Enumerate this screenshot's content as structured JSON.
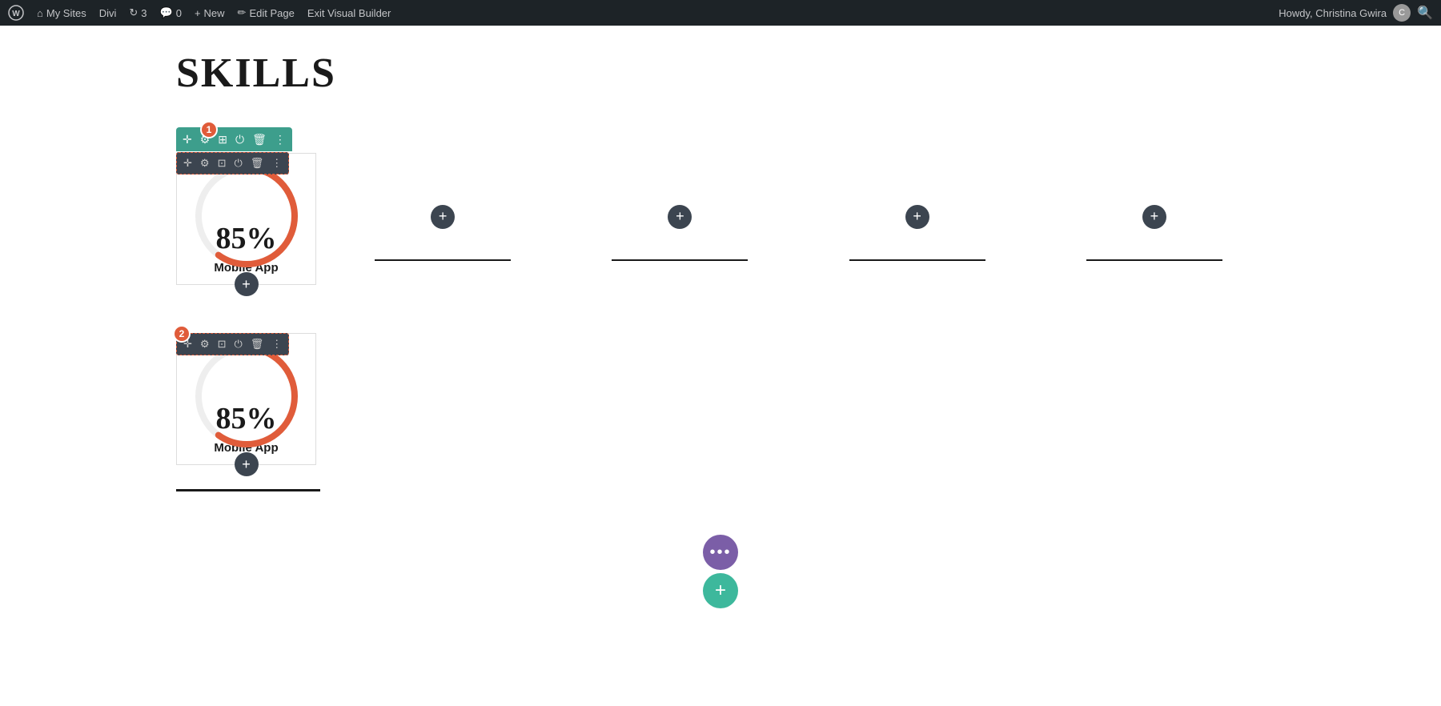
{
  "adminBar": {
    "wpLogo": "W",
    "mySites": "My Sites",
    "divi": "Divi",
    "comments": "3",
    "commentCount": "0",
    "new": "New",
    "editPage": "Edit Page",
    "exitBuilder": "Exit Visual Builder",
    "howdy": "Howdy, Christina Gwira",
    "searchIcon": "🔍"
  },
  "page": {
    "title": "SKILLS"
  },
  "module1": {
    "percent": "85%",
    "label": "Mobile App",
    "badge": "1",
    "progressValue": 85
  },
  "module2": {
    "percent": "85%",
    "label": "Mobile App",
    "badge": "2",
    "progressValue": 85
  },
  "toolbar": {
    "icons": [
      "✛",
      "⚙",
      "⊞",
      "⏻",
      "🗑",
      "⋮"
    ],
    "rowIcons": [
      "✛",
      "⚙",
      "⊡",
      "⏻",
      "🗑",
      "⋮"
    ]
  },
  "placeholders": [
    {
      "id": "col2"
    },
    {
      "id": "col3"
    },
    {
      "id": "col4"
    },
    {
      "id": "col5"
    }
  ],
  "fab": {
    "more": "•••",
    "add": "+"
  }
}
